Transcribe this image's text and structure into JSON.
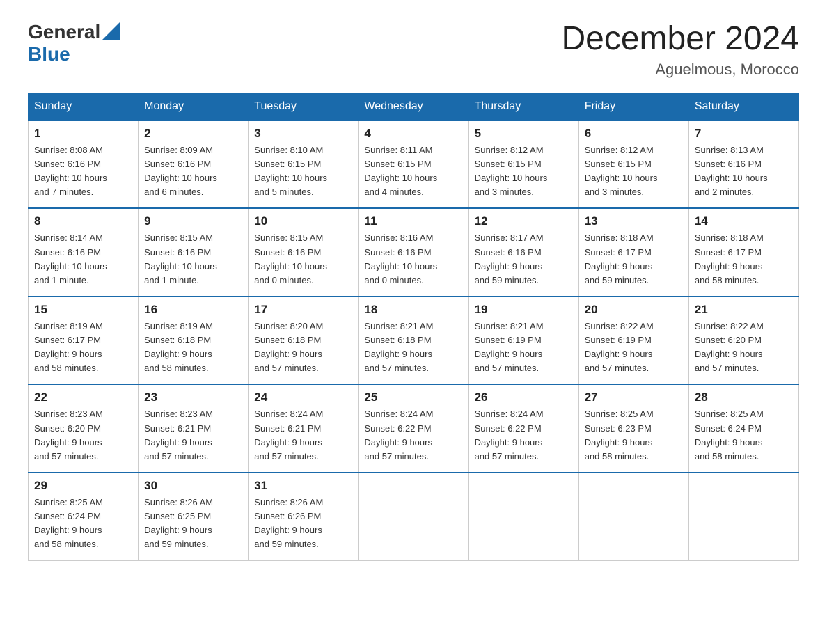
{
  "header": {
    "logo_general": "General",
    "logo_blue": "Blue",
    "title": "December 2024",
    "subtitle": "Aguelmous, Morocco"
  },
  "days_of_week": [
    "Sunday",
    "Monday",
    "Tuesday",
    "Wednesday",
    "Thursday",
    "Friday",
    "Saturday"
  ],
  "weeks": [
    [
      {
        "day": "1",
        "sunrise": "8:08 AM",
        "sunset": "6:16 PM",
        "daylight": "10 hours and 7 minutes."
      },
      {
        "day": "2",
        "sunrise": "8:09 AM",
        "sunset": "6:16 PM",
        "daylight": "10 hours and 6 minutes."
      },
      {
        "day": "3",
        "sunrise": "8:10 AM",
        "sunset": "6:15 PM",
        "daylight": "10 hours and 5 minutes."
      },
      {
        "day": "4",
        "sunrise": "8:11 AM",
        "sunset": "6:15 PM",
        "daylight": "10 hours and 4 minutes."
      },
      {
        "day": "5",
        "sunrise": "8:12 AM",
        "sunset": "6:15 PM",
        "daylight": "10 hours and 3 minutes."
      },
      {
        "day": "6",
        "sunrise": "8:12 AM",
        "sunset": "6:15 PM",
        "daylight": "10 hours and 3 minutes."
      },
      {
        "day": "7",
        "sunrise": "8:13 AM",
        "sunset": "6:16 PM",
        "daylight": "10 hours and 2 minutes."
      }
    ],
    [
      {
        "day": "8",
        "sunrise": "8:14 AM",
        "sunset": "6:16 PM",
        "daylight": "10 hours and 1 minute."
      },
      {
        "day": "9",
        "sunrise": "8:15 AM",
        "sunset": "6:16 PM",
        "daylight": "10 hours and 1 minute."
      },
      {
        "day": "10",
        "sunrise": "8:15 AM",
        "sunset": "6:16 PM",
        "daylight": "10 hours and 0 minutes."
      },
      {
        "day": "11",
        "sunrise": "8:16 AM",
        "sunset": "6:16 PM",
        "daylight": "10 hours and 0 minutes."
      },
      {
        "day": "12",
        "sunrise": "8:17 AM",
        "sunset": "6:16 PM",
        "daylight": "9 hours and 59 minutes."
      },
      {
        "day": "13",
        "sunrise": "8:18 AM",
        "sunset": "6:17 PM",
        "daylight": "9 hours and 59 minutes."
      },
      {
        "day": "14",
        "sunrise": "8:18 AM",
        "sunset": "6:17 PM",
        "daylight": "9 hours and 58 minutes."
      }
    ],
    [
      {
        "day": "15",
        "sunrise": "8:19 AM",
        "sunset": "6:17 PM",
        "daylight": "9 hours and 58 minutes."
      },
      {
        "day": "16",
        "sunrise": "8:19 AM",
        "sunset": "6:18 PM",
        "daylight": "9 hours and 58 minutes."
      },
      {
        "day": "17",
        "sunrise": "8:20 AM",
        "sunset": "6:18 PM",
        "daylight": "9 hours and 57 minutes."
      },
      {
        "day": "18",
        "sunrise": "8:21 AM",
        "sunset": "6:18 PM",
        "daylight": "9 hours and 57 minutes."
      },
      {
        "day": "19",
        "sunrise": "8:21 AM",
        "sunset": "6:19 PM",
        "daylight": "9 hours and 57 minutes."
      },
      {
        "day": "20",
        "sunrise": "8:22 AM",
        "sunset": "6:19 PM",
        "daylight": "9 hours and 57 minutes."
      },
      {
        "day": "21",
        "sunrise": "8:22 AM",
        "sunset": "6:20 PM",
        "daylight": "9 hours and 57 minutes."
      }
    ],
    [
      {
        "day": "22",
        "sunrise": "8:23 AM",
        "sunset": "6:20 PM",
        "daylight": "9 hours and 57 minutes."
      },
      {
        "day": "23",
        "sunrise": "8:23 AM",
        "sunset": "6:21 PM",
        "daylight": "9 hours and 57 minutes."
      },
      {
        "day": "24",
        "sunrise": "8:24 AM",
        "sunset": "6:21 PM",
        "daylight": "9 hours and 57 minutes."
      },
      {
        "day": "25",
        "sunrise": "8:24 AM",
        "sunset": "6:22 PM",
        "daylight": "9 hours and 57 minutes."
      },
      {
        "day": "26",
        "sunrise": "8:24 AM",
        "sunset": "6:22 PM",
        "daylight": "9 hours and 57 minutes."
      },
      {
        "day": "27",
        "sunrise": "8:25 AM",
        "sunset": "6:23 PM",
        "daylight": "9 hours and 58 minutes."
      },
      {
        "day": "28",
        "sunrise": "8:25 AM",
        "sunset": "6:24 PM",
        "daylight": "9 hours and 58 minutes."
      }
    ],
    [
      {
        "day": "29",
        "sunrise": "8:25 AM",
        "sunset": "6:24 PM",
        "daylight": "9 hours and 58 minutes."
      },
      {
        "day": "30",
        "sunrise": "8:26 AM",
        "sunset": "6:25 PM",
        "daylight": "9 hours and 59 minutes."
      },
      {
        "day": "31",
        "sunrise": "8:26 AM",
        "sunset": "6:26 PM",
        "daylight": "9 hours and 59 minutes."
      },
      null,
      null,
      null,
      null
    ]
  ],
  "labels": {
    "sunrise": "Sunrise:",
    "sunset": "Sunset:",
    "daylight": "Daylight:"
  }
}
